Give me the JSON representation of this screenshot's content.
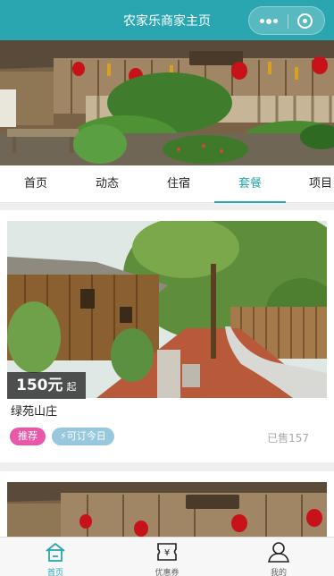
{
  "header": {
    "title": "农家乐商家主页"
  },
  "colors": {
    "accent": "#2aa6b0",
    "recommend": "#e858a8",
    "bookable": "#98c8de"
  },
  "tabs": [
    {
      "label": "首页"
    },
    {
      "label": "动态"
    },
    {
      "label": "住宿"
    },
    {
      "label": "套餐",
      "active": true
    },
    {
      "label": "项目"
    }
  ],
  "package": {
    "price": "150元",
    "price_suffix": "起",
    "name": "绿苑山庄",
    "badge_recommend": "推荐",
    "badge_bookable": "可订今日",
    "sold": "已售157"
  },
  "bottom_nav": [
    {
      "label": "首页",
      "icon": "home-icon",
      "active": true
    },
    {
      "label": "优惠券",
      "icon": "coupon-icon"
    },
    {
      "label": "我的",
      "icon": "user-icon"
    }
  ]
}
